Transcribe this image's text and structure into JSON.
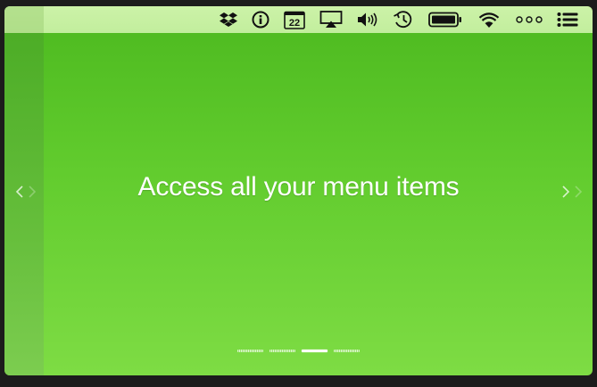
{
  "menubar": {
    "status_icons": [
      {
        "name": "dropbox-icon"
      },
      {
        "name": "info-icon"
      },
      {
        "name": "calendar-icon",
        "text": "22"
      },
      {
        "name": "airplay-icon"
      },
      {
        "name": "volume-icon"
      },
      {
        "name": "time-machine-icon"
      },
      {
        "name": "battery-icon"
      },
      {
        "name": "wifi-icon"
      },
      {
        "name": "more-icon"
      },
      {
        "name": "notification-center-icon"
      }
    ]
  },
  "slide": {
    "headline": "Access all your menu items"
  },
  "pager": {
    "count": 4,
    "active_index": 2
  },
  "colors": {
    "accent": "#5ec52b",
    "menubar": "#c6f0a0",
    "text": "#ffffff"
  }
}
